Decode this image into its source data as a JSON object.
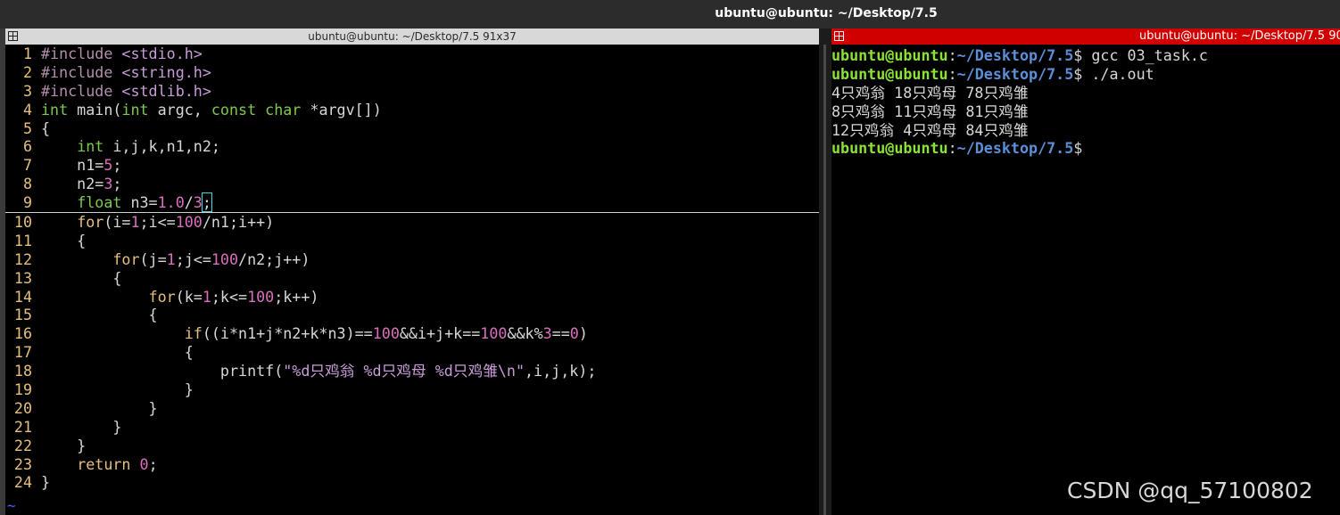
{
  "window": {
    "title": "ubuntu@ubuntu: ~/Desktop/7.5"
  },
  "left_pane": {
    "title": "ubuntu@ubuntu: ~/Desktop/7.5 91x37"
  },
  "right_pane": {
    "title": "ubuntu@ubuntu: ~/Desktop/7.5 90"
  },
  "editor": {
    "lines": [
      [
        "1",
        "#include <stdio.h>"
      ],
      [
        "2",
        "#include <string.h>"
      ],
      [
        "3",
        "#include <stdlib.h>"
      ],
      [
        "4",
        "int main(int argc, const char *argv[])"
      ],
      [
        "5",
        "{"
      ],
      [
        "6",
        "int i,j,k,n1,n2;"
      ],
      [
        "7",
        "n1=5;"
      ],
      [
        "8",
        "n2=3;"
      ],
      [
        "9",
        "float n3=1.0/3;"
      ],
      [
        "10",
        "for(i=1;i<=100/n1;i++)"
      ],
      [
        "11",
        "{"
      ],
      [
        "12",
        "for(j=1;j<=100/n2;j++)"
      ],
      [
        "13",
        "{"
      ],
      [
        "14",
        "for(k=1;k<=100;k++)"
      ],
      [
        "15",
        "{"
      ],
      [
        "16",
        "if((i*n1+j*n2+k*n3)==100&&i+j+k==100&&k%3==0)"
      ],
      [
        "17",
        "{"
      ],
      [
        "18",
        "printf(\"%d只鸡翁 %d只鸡母 %d只鸡雏\\n\",i,j,k);"
      ],
      [
        "19",
        "}"
      ],
      [
        "20",
        "}"
      ],
      [
        "21",
        "}"
      ],
      [
        "22",
        "}"
      ],
      [
        "23",
        "return 0;"
      ],
      [
        "24",
        "}"
      ]
    ],
    "tilde": "~"
  },
  "terminal": {
    "prompt_user": "ubuntu@ubuntu",
    "prompt_sep": ":",
    "prompt_path": "~/Desktop/7.5",
    "prompt_end": "$",
    "cmd1": " gcc 03_task.c",
    "cmd2": " ./a.out",
    "out1": "4只鸡翁 18只鸡母 78只鸡雏",
    "out2": "8只鸡翁 11只鸡母 81只鸡雏",
    "out3": "12只鸡翁 4只鸡母 84只鸡雏"
  },
  "watermark": "CSDN @qq_57100802",
  "colors": {
    "prompt_user": "#8ae234",
    "prompt_path": "#5c8fd6",
    "right_header": "#d00000",
    "line_numbers": "#e5c07b"
  }
}
